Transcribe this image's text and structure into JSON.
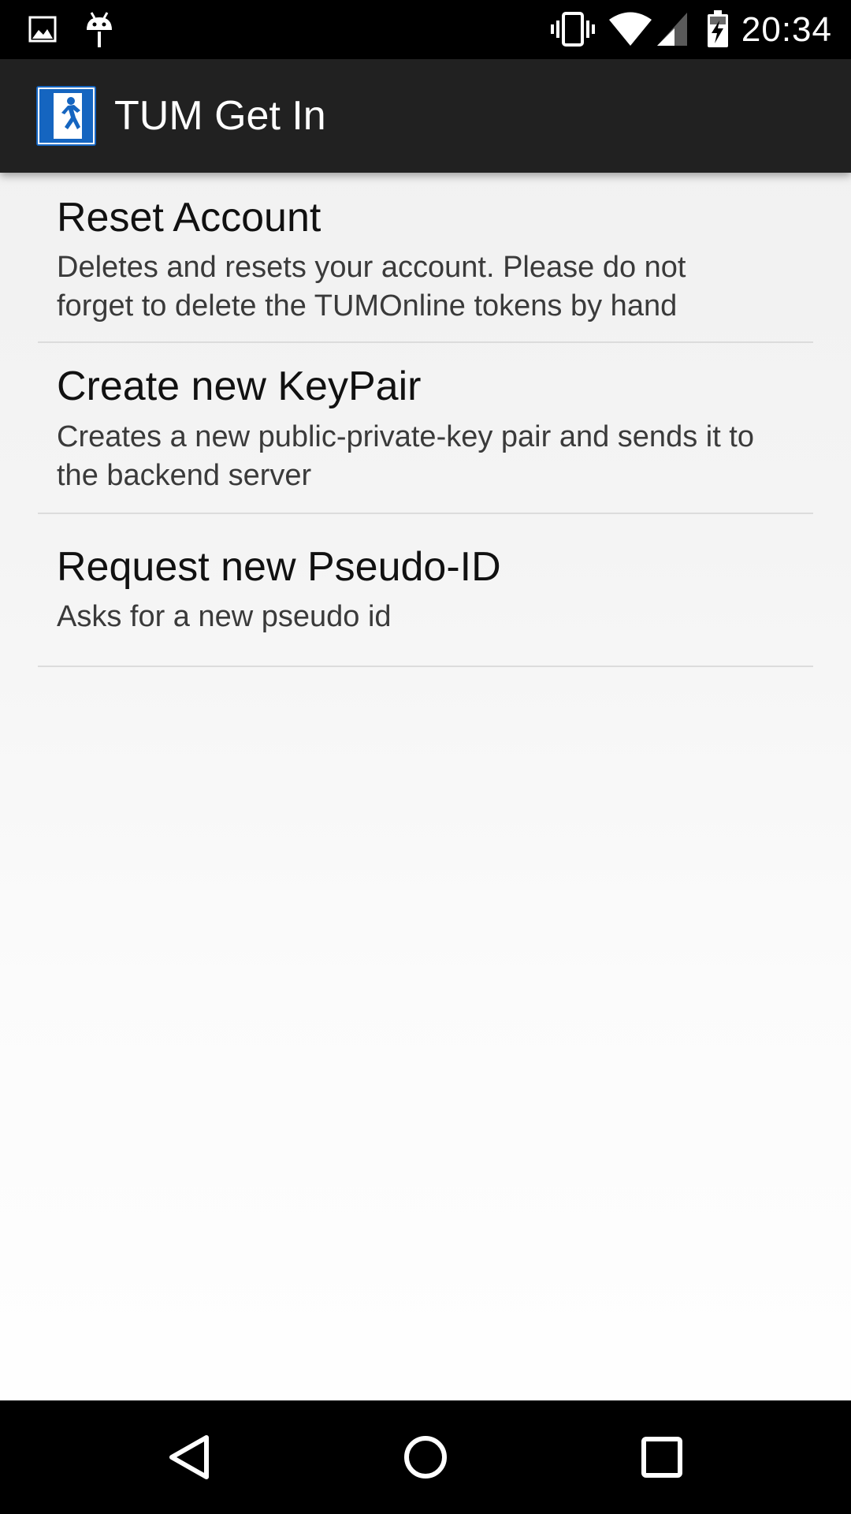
{
  "status_bar": {
    "time": "20:34",
    "icons": [
      "image-notification-icon",
      "android-debug-icon",
      "vibrate-icon",
      "wifi-icon",
      "cell-signal-icon",
      "battery-charging-icon"
    ]
  },
  "app_bar": {
    "title": "TUM Get In",
    "icon": "exit-sign-icon",
    "icon_color": "#1565c0"
  },
  "preferences": [
    {
      "title": "Reset Account",
      "summary": "Deletes and resets your account. Please do not forget to delete the TUMOnline tokens by hand"
    },
    {
      "title": "Create new KeyPair",
      "summary": "Creates a new public-private-key pair and sends it to the backend server"
    },
    {
      "title": "Request new Pseudo-ID",
      "summary": "Asks for a new pseudo id"
    }
  ],
  "nav_bar": {
    "buttons": [
      "back-icon",
      "home-icon",
      "recents-icon"
    ]
  }
}
